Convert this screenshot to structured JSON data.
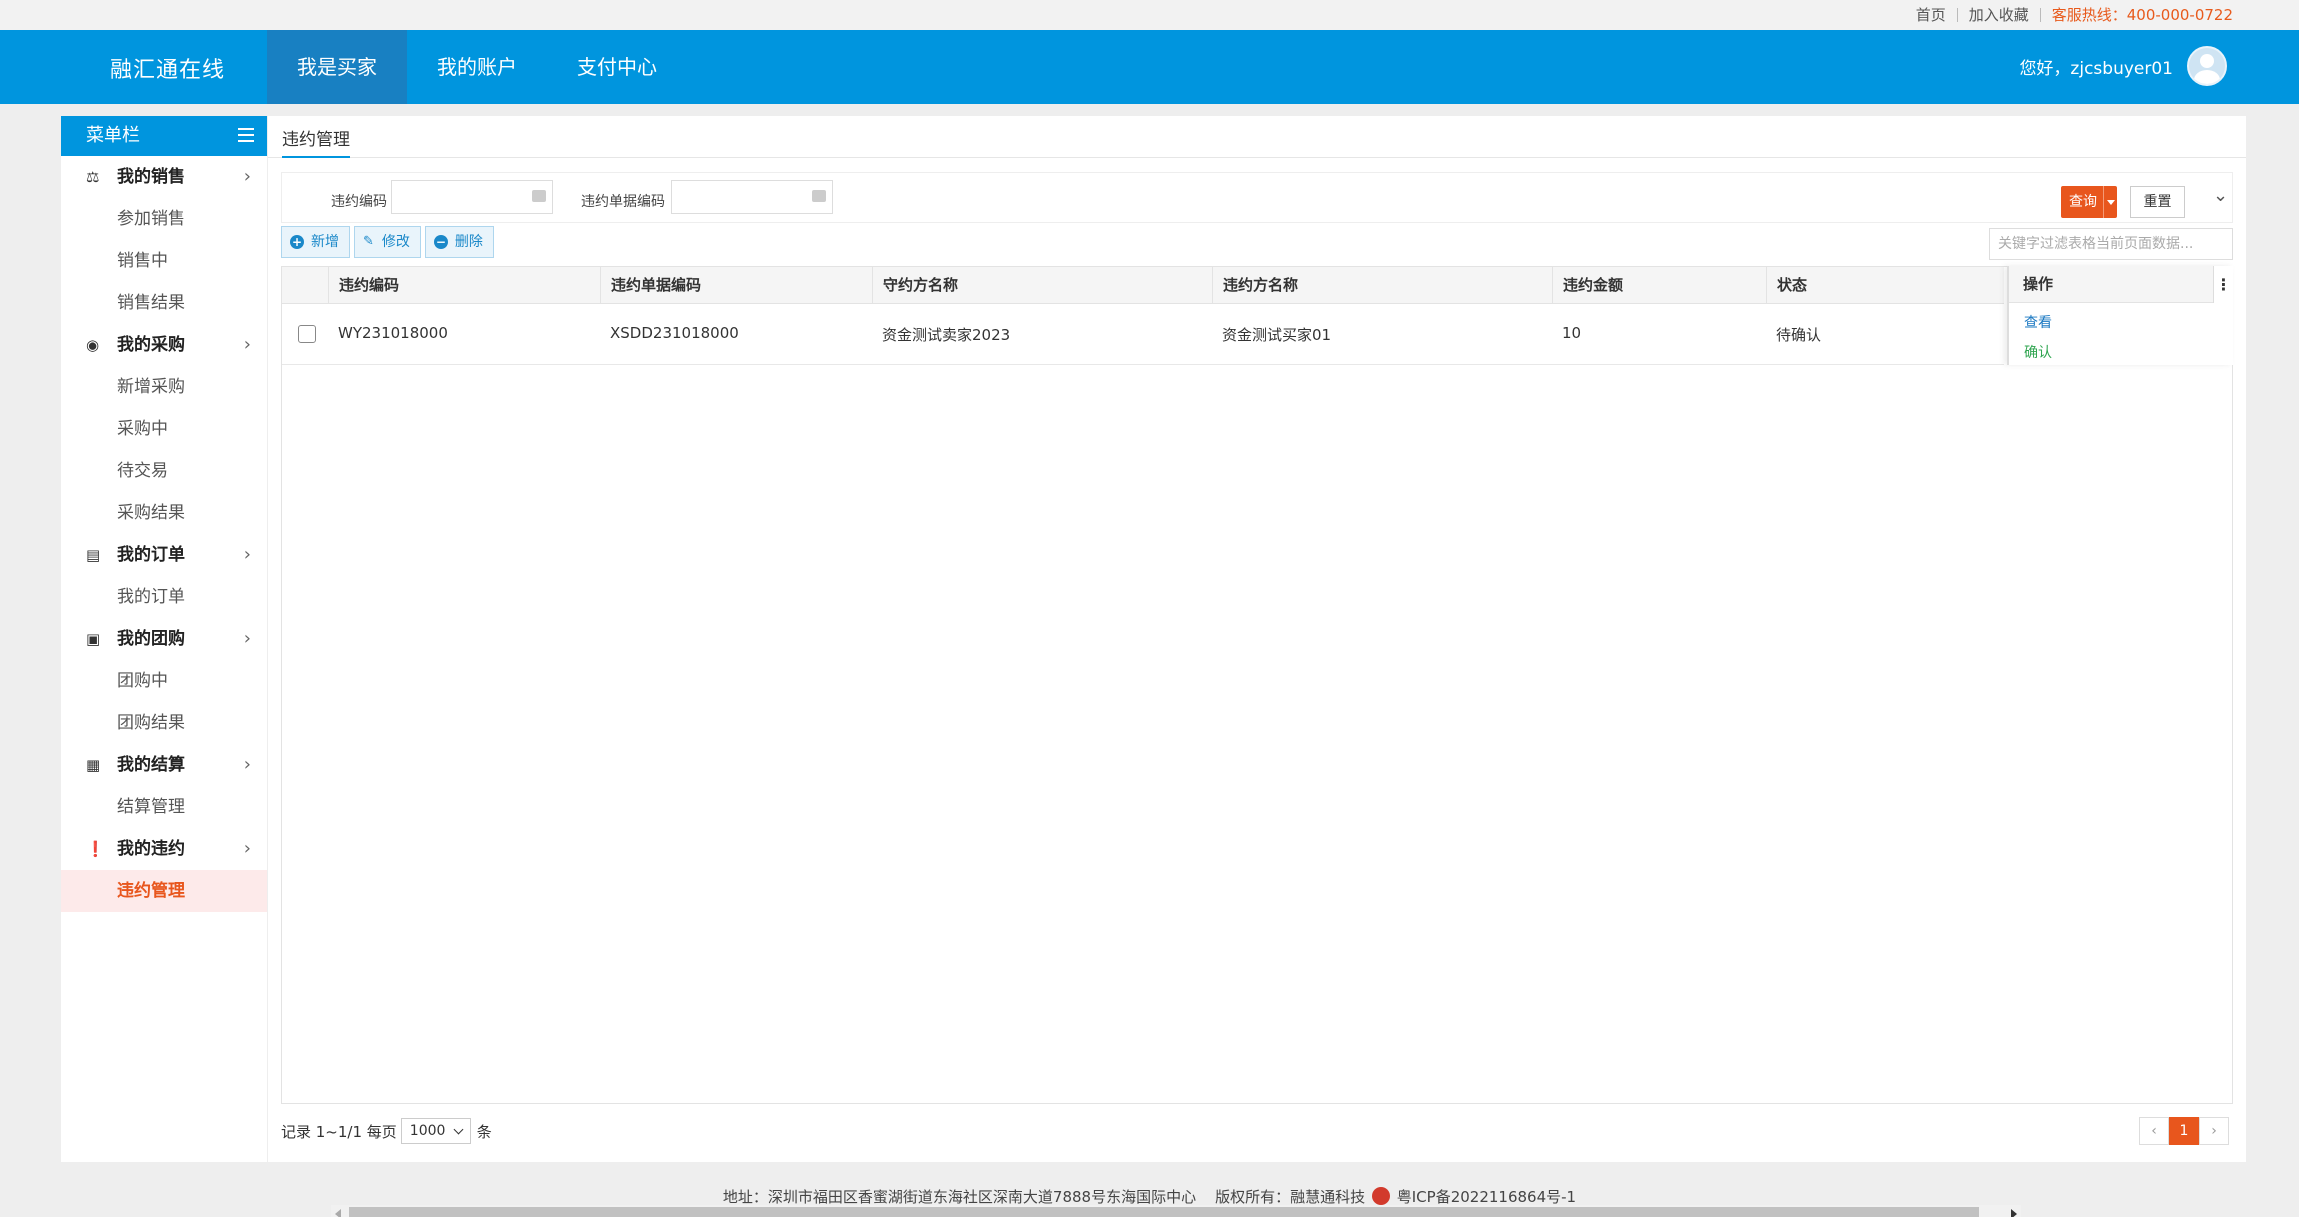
{
  "topbar": {
    "home": "首页",
    "favorite": "加入收藏",
    "hotline": "客服热线：400-000-0722"
  },
  "header": {
    "brand": "融汇通在线",
    "nav": [
      "我是买家",
      "我的账户",
      "支付中心"
    ],
    "greeting": "您好，zjcsbuyer01"
  },
  "sidebar": {
    "title": "菜单栏",
    "groups": [
      {
        "label": "我的销售",
        "icon": "gavel-icon",
        "items": [
          "参加销售",
          "销售中",
          "销售结果"
        ]
      },
      {
        "label": "我的采购",
        "icon": "search-circle-icon",
        "items": [
          "新增采购",
          "采购中",
          "待交易",
          "采购结果"
        ]
      },
      {
        "label": "我的订单",
        "icon": "document-icon",
        "items": [
          "我的订单"
        ]
      },
      {
        "label": "我的团购",
        "icon": "bag-icon",
        "items": [
          "团购中",
          "团购结果"
        ]
      },
      {
        "label": "我的结算",
        "icon": "calculator-icon",
        "items": [
          "结算管理"
        ]
      },
      {
        "label": "我的违约",
        "icon": "alert-circle-icon",
        "items": [
          "违约管理"
        ]
      }
    ],
    "active_item": "违约管理"
  },
  "main": {
    "tab": "违约管理",
    "search": {
      "field1_label": "违约编码",
      "field1_value": "",
      "field2_label": "违约单据编码",
      "field2_value": "",
      "query": "查询",
      "reset": "重置"
    },
    "toolbar": {
      "add": "新增",
      "edit": "修改",
      "delete": "删除"
    },
    "filter_placeholder": "关键字过滤表格当前页面数据...",
    "table": {
      "columns": [
        "违约编码",
        "违约单据编码",
        "守约方名称",
        "违约方名称",
        "违约金额",
        "状态",
        "操作"
      ],
      "rows": [
        {
          "code": "WY231018000",
          "doc_code": "XSDD231018000",
          "keeper": "资金测试卖家2023",
          "breacher": "资金测试买家01",
          "amount": "10",
          "status": "待确认",
          "actions": [
            "查看",
            "确认"
          ]
        }
      ]
    },
    "pager": {
      "prefix": "记录 1~1/1 每页",
      "page_size": "1000",
      "suffix": "条",
      "current_page": "1"
    }
  },
  "footer": {
    "address": "地址：深圳市福田区香蜜湖街道东海社区深南大道7888号东海国际中心",
    "copyright": "版权所有：融慧通科技",
    "icp": "粤ICP备2022116864号-1"
  },
  "colors": {
    "primary": "#0095de",
    "accent": "#e8561d",
    "confirm": "#2ea44f"
  }
}
